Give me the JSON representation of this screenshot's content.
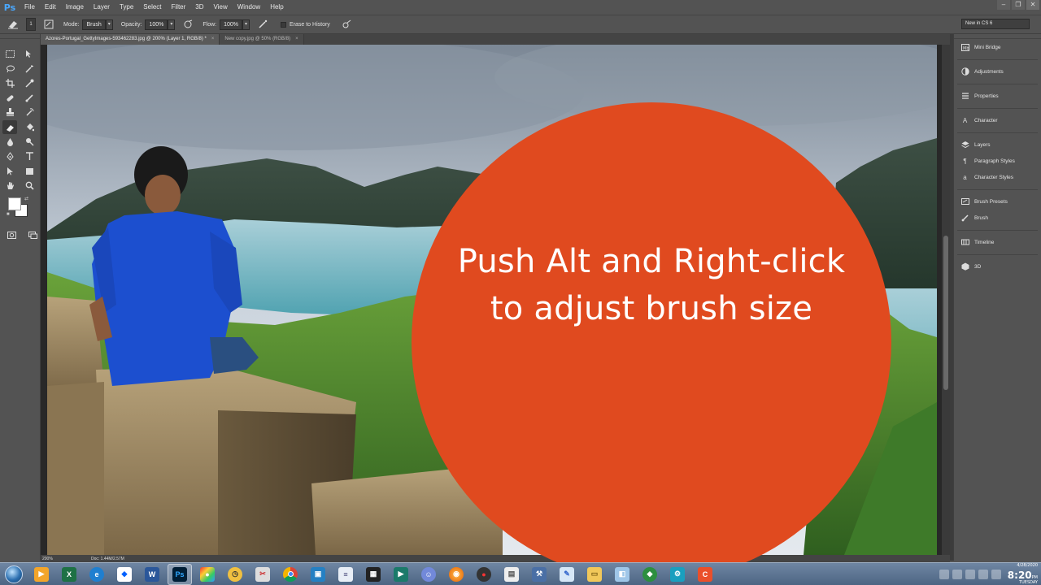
{
  "app": {
    "logo": "Ps"
  },
  "menu": [
    "File",
    "Edit",
    "Image",
    "Layer",
    "Type",
    "Select",
    "Filter",
    "3D",
    "View",
    "Window",
    "Help"
  ],
  "window_controls": [
    "–",
    "❐",
    "✕"
  ],
  "options_bar": {
    "brush_size": "1",
    "mode_label": "Mode:",
    "mode_value": "Brush",
    "opacity_label": "Opacity:",
    "opacity_value": "100%",
    "flow_label": "Flow:",
    "flow_value": "100%",
    "erase_history_label": "Erase to History",
    "workspace": "New in CS 6"
  },
  "tabs": [
    {
      "label": "Azores-Portugal_GettyImages-593462283.jpg @ 200% (Layer 1, RGB/8) *",
      "close": "×",
      "active": true
    },
    {
      "label": "New copy.jpg @ 50% (RGB/8)",
      "close": "×",
      "active": false
    }
  ],
  "status": {
    "zoom": "200%",
    "doc": "Doc: 1.44M/2.57M"
  },
  "panels": [
    {
      "label": "Mini Bridge",
      "icon": "mini-bridge-icon"
    },
    {
      "label": "Adjustments",
      "icon": "adjustments-icon"
    },
    {
      "label": "Properties",
      "icon": "properties-icon"
    },
    {
      "label": "Character",
      "icon": "character-icon"
    },
    {
      "label": "Layers",
      "icon": "layers-icon"
    },
    {
      "label": "Paragraph Styles",
      "icon": "paragraph-styles-icon"
    },
    {
      "label": "Character Styles",
      "icon": "character-styles-icon"
    },
    {
      "label": "Brush Presets",
      "icon": "brush-presets-icon"
    },
    {
      "label": "Brush",
      "icon": "brush-icon"
    },
    {
      "label": "Timeline",
      "icon": "timeline-icon"
    },
    {
      "label": "3D",
      "icon": "3d-icon"
    }
  ],
  "overlay": {
    "line1": "Push Alt and Right-click",
    "line2": "to adjust brush size",
    "color": "#e04a1f"
  },
  "taskbar": {
    "clock_date": "4/28/2020",
    "clock_time": "8:20",
    "clock_ampm": "PM",
    "clock_day": "TUESDAY",
    "apps": [
      "media-player-icon",
      "excel-icon",
      "edge-icon",
      "dropbox-icon",
      "word-icon",
      "photoshop-icon",
      "colorful-app-icon",
      "alarm-clock-icon",
      "snipping-tool-icon",
      "chrome-icon",
      "box-app-icon",
      "notepad-icon",
      "video-editor-icon",
      "play-app-icon",
      "discord-icon",
      "firefox-icon",
      "record-icon",
      "file-icon",
      "tool-icon",
      "paint-icon",
      "explorer-icon",
      "app-icon",
      "globe-app-icon",
      "settings-icon",
      "camtasia-icon"
    ]
  }
}
